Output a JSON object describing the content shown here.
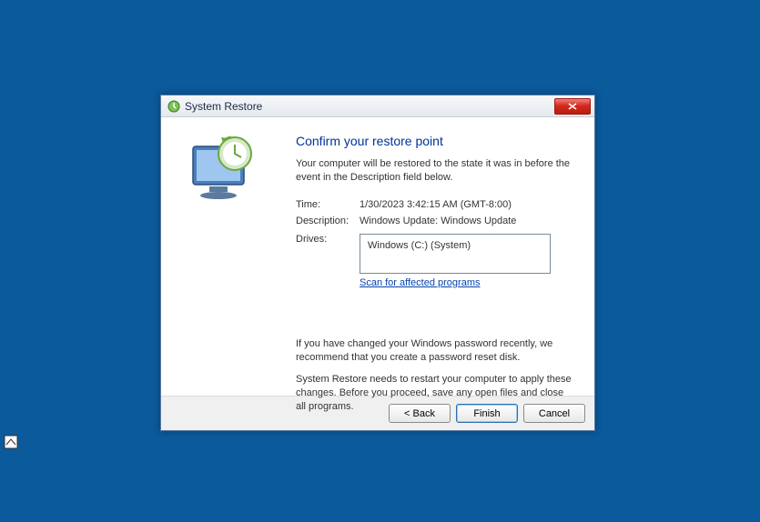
{
  "window": {
    "title": "System Restore",
    "icon": "system-restore-icon"
  },
  "heading": "Confirm your restore point",
  "subtext": "Your computer will be restored to the state it was in before the event in the Description field below.",
  "fields": {
    "time_label": "Time:",
    "time_value": "1/30/2023 3:42:15 AM (GMT-8:00)",
    "description_label": "Description:",
    "description_value": "Windows Update: Windows Update",
    "drives_label": "Drives:",
    "drives_value": "Windows (C:) (System)"
  },
  "scan_link": "Scan for affected programs",
  "notes": {
    "p1": "If you have changed your Windows password recently, we recommend that you create a password reset disk.",
    "p2": "System Restore needs to restart your computer to apply these changes. Before you proceed, save any open files and close all programs."
  },
  "buttons": {
    "back": "< Back",
    "finish": "Finish",
    "cancel": "Cancel"
  }
}
